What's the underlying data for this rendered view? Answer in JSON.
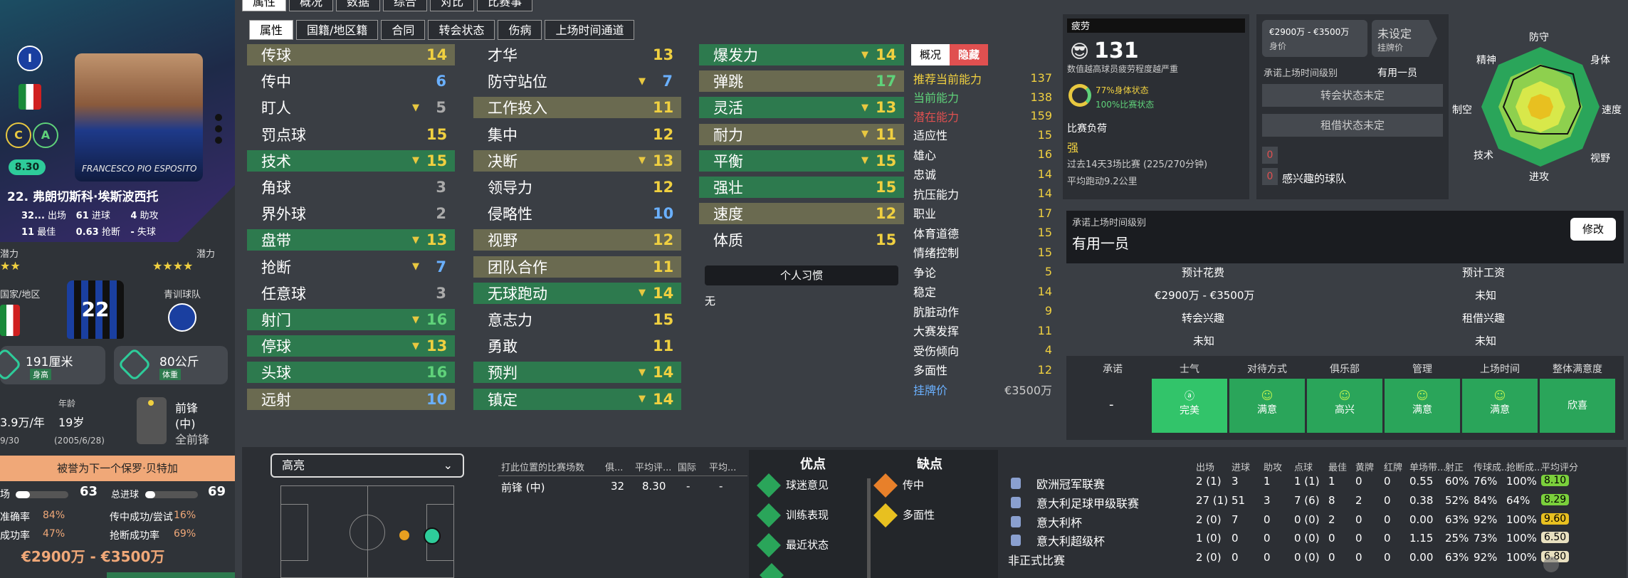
{
  "card": {
    "rating": "8.30",
    "photo_name": "FRANCESCO PIO ESPOSITO",
    "name": "22. 弗朗切斯科·埃斯波西托",
    "badge_c": "C",
    "badge_a": "A",
    "nation_short": "ITALIA",
    "stats": [
      {
        "v": "32...",
        "k": "出场"
      },
      {
        "v": "61",
        "k": "进球"
      },
      {
        "v": "4",
        "k": "助攻"
      },
      {
        "v": "11",
        "k": "最佳"
      },
      {
        "v": "0.63",
        "k": "抢断"
      },
      {
        "v": "-",
        "k": "失球"
      }
    ],
    "potential_left": "潜力",
    "potential_right": "潜力",
    "left_stars": "★★",
    "right_stars": "★★★★",
    "nation_label": "国家/地区",
    "kit_number": "22",
    "youth_label": "青训球队",
    "height": "191厘米",
    "height_sub": "身高",
    "weight": "80公斤",
    "weight_sub": "体重",
    "wage": "3.9万/年",
    "age_label": "年龄",
    "age": "19岁",
    "contract_end": "9/30",
    "dob": "(2005/6/28)",
    "pos_main": "前锋",
    "pos_sub": "(中)",
    "pos_all": "全前锋",
    "compare_banner": "被誉为下一个保罗·贝特加",
    "goals_left_label": "场",
    "goals_left": "63",
    "goals_total_label": "总进球",
    "goals_total": "69",
    "rates": [
      {
        "k": "准确率",
        "v": "84%",
        "k2": "传中成功/尝试",
        "v2": "16%"
      },
      {
        "k": "成功率",
        "v": "47%",
        "k2": "抢断成功率",
        "v2": "69%"
      }
    ],
    "value": "€2900万 - €3500万"
  },
  "tabs_top": [
    "属性",
    "概况",
    "数据",
    "综合",
    "对比",
    "比赛事"
  ],
  "tabs2": [
    "属性",
    "国籍/地区籍",
    "合同",
    "转会状态",
    "伤病",
    "上场时间通道"
  ],
  "attrs_tech": [
    {
      "n": "传球",
      "v": "14",
      "arrow": "",
      "bg": "y",
      "c": "v-y"
    },
    {
      "n": "传中",
      "v": "6",
      "arrow": "",
      "bg": "",
      "c": "v-b"
    },
    {
      "n": "盯人",
      "v": "5",
      "arrow": "▼",
      "bg": "",
      "c": "v-g"
    },
    {
      "n": "罚点球",
      "v": "15",
      "arrow": "",
      "bg": "",
      "c": "v-y"
    },
    {
      "n": "技术",
      "v": "15",
      "arrow": "▼",
      "bg": "g",
      "c": "v-y"
    },
    {
      "n": "角球",
      "v": "3",
      "arrow": "",
      "bg": "",
      "c": "v-g"
    },
    {
      "n": "界外球",
      "v": "2",
      "arrow": "",
      "bg": "",
      "c": "v-g"
    },
    {
      "n": "盘带",
      "v": "13",
      "arrow": "▼",
      "bg": "g",
      "c": "v-y"
    },
    {
      "n": "抢断",
      "v": "7",
      "arrow": "▼",
      "bg": "",
      "c": "v-b"
    },
    {
      "n": "任意球",
      "v": "3",
      "arrow": "",
      "bg": "",
      "c": "v-g"
    },
    {
      "n": "射门",
      "v": "16",
      "arrow": "▼",
      "bg": "g",
      "c": "v-gr"
    },
    {
      "n": "停球",
      "v": "13",
      "arrow": "▼",
      "bg": "g",
      "c": "v-y"
    },
    {
      "n": "头球",
      "v": "16",
      "arrow": "",
      "bg": "g",
      "c": "v-gr"
    },
    {
      "n": "远射",
      "v": "10",
      "arrow": "",
      "bg": "y",
      "c": "v-b"
    }
  ],
  "attrs_mental": [
    {
      "n": "才华",
      "v": "13",
      "arrow": "",
      "bg": "",
      "c": "v-y"
    },
    {
      "n": "防守站位",
      "v": "7",
      "arrow": "▼",
      "bg": "",
      "c": "v-b"
    },
    {
      "n": "工作投入",
      "v": "11",
      "arrow": "",
      "bg": "y",
      "c": "v-y"
    },
    {
      "n": "集中",
      "v": "12",
      "arrow": "",
      "bg": "",
      "c": "v-y"
    },
    {
      "n": "决断",
      "v": "13",
      "arrow": "▼",
      "bg": "y",
      "c": "v-y"
    },
    {
      "n": "领导力",
      "v": "12",
      "arrow": "",
      "bg": "",
      "c": "v-y"
    },
    {
      "n": "侵略性",
      "v": "10",
      "arrow": "",
      "bg": "",
      "c": "v-b"
    },
    {
      "n": "视野",
      "v": "12",
      "arrow": "",
      "bg": "y",
      "c": "v-y"
    },
    {
      "n": "团队合作",
      "v": "11",
      "arrow": "",
      "bg": "y",
      "c": "v-y"
    },
    {
      "n": "无球跑动",
      "v": "14",
      "arrow": "▼",
      "bg": "g",
      "c": "v-y"
    },
    {
      "n": "意志力",
      "v": "15",
      "arrow": "",
      "bg": "",
      "c": "v-y"
    },
    {
      "n": "勇敢",
      "v": "11",
      "arrow": "",
      "bg": "",
      "c": "v-y"
    },
    {
      "n": "预判",
      "v": "14",
      "arrow": "▼",
      "bg": "g",
      "c": "v-y"
    },
    {
      "n": "镇定",
      "v": "14",
      "arrow": "▼",
      "bg": "g",
      "c": "v-y"
    }
  ],
  "attrs_phys": [
    {
      "n": "爆发力",
      "v": "14",
      "arrow": "▼",
      "bg": "g",
      "c": "v-y"
    },
    {
      "n": "弹跳",
      "v": "17",
      "arrow": "",
      "bg": "y",
      "c": "v-gr"
    },
    {
      "n": "灵活",
      "v": "13",
      "arrow": "▼",
      "bg": "g",
      "c": "v-y"
    },
    {
      "n": "耐力",
      "v": "11",
      "arrow": "▼",
      "bg": "y",
      "c": "v-y"
    },
    {
      "n": "平衡",
      "v": "15",
      "arrow": "▼",
      "bg": "g",
      "c": "v-y"
    },
    {
      "n": "强壮",
      "v": "15",
      "arrow": "",
      "bg": "g",
      "c": "v-y"
    },
    {
      "n": "速度",
      "v": "12",
      "arrow": "",
      "bg": "y",
      "c": "v-y"
    },
    {
      "n": "体质",
      "v": "15",
      "arrow": "",
      "bg": "",
      "c": "v-y"
    }
  ],
  "traits_header": "个人习惯",
  "traits_none": "无",
  "side_tabs": [
    "概况",
    "隐藏"
  ],
  "side_ca": [
    {
      "k": "推荐当前能力",
      "v": "137",
      "kc": "#f0d040"
    },
    {
      "k": "当前能力",
      "v": "138",
      "kc": "#5fd27a"
    },
    {
      "k": "潜在能力",
      "v": "159",
      "kc": "#e05050"
    }
  ],
  "side_hidden": [
    {
      "k": "适应性",
      "v": "15"
    },
    {
      "k": "雄心",
      "v": "16"
    },
    {
      "k": "忠诚",
      "v": "14"
    },
    {
      "k": "抗压能力",
      "v": "14"
    },
    {
      "k": "职业",
      "v": "17"
    },
    {
      "k": "体育道德",
      "v": "15"
    },
    {
      "k": "情绪控制",
      "v": "15"
    },
    {
      "k": "争论",
      "v": "5"
    },
    {
      "k": "稳定",
      "v": "14"
    },
    {
      "k": "肮脏动作",
      "v": "9"
    },
    {
      "k": "大赛发挥",
      "v": "11"
    },
    {
      "k": "受伤倾向",
      "v": "4"
    },
    {
      "k": "多面性",
      "v": "12"
    }
  ],
  "side_value_label": "挂牌价",
  "side_value": "€3500万",
  "fatigue": {
    "label": "疲劳",
    "value": "131",
    "desc": "数值越高球员疲劳程度越严重",
    "phys": "77%身体状态",
    "match": "100%比赛状态",
    "load_label": "比赛负荷",
    "load_value": "强",
    "load_desc": "过去14天3场比赛 (225/270分钟)",
    "distance": "平均跑动9.2公里"
  },
  "transfer": {
    "value": "€2900万 - €3500万",
    "value_sub": "身价",
    "asking": "未设定",
    "asking_sub": "挂牌价",
    "promise_label": "承诺上场时间级别",
    "promise_value": "有用一员",
    "status1": "转会状态未定",
    "status2": "租借状态未定",
    "interest_count1": "0",
    "interest_count2": "0",
    "interest_label": "感兴趣的球队"
  },
  "radar": {
    "labels": [
      "防守",
      "身体",
      "速度",
      "视野",
      "进攻",
      "技术",
      "制空",
      "精神"
    ]
  },
  "promise_box": {
    "label": "承诺上场时间级别",
    "value": "有用一员",
    "button": "修改"
  },
  "forecast": {
    "fee_label": "预计花费",
    "fee": "€2900万 - €3500万",
    "wage_label": "预计工资",
    "wage": "未知",
    "transfer_interest_label": "转会兴趣",
    "transfer_interest": "未知",
    "loan_interest_label": "租借兴趣",
    "loan_interest": "未知"
  },
  "satisfaction": {
    "heads": [
      "承诺",
      "士气",
      "对待方式",
      "俱乐部",
      "管理",
      "上场时间",
      "整体满意度"
    ],
    "promise": "-",
    "cells": [
      "完美",
      "满意",
      "高兴",
      "满意",
      "满意",
      "欣喜"
    ]
  },
  "highlight_select": "高亮",
  "positions_table": {
    "heads": [
      "打此位置的比赛场数",
      "俱...",
      "平均评...",
      "国际",
      "平均..."
    ],
    "row": [
      "前锋 (中)",
      "32",
      "8.30",
      "-",
      "-"
    ]
  },
  "pros_label": "优点",
  "cons_label": "缺点",
  "pros": [
    "球迷意见",
    "训练表现",
    "最近状态"
  ],
  "cons": [
    "传中",
    "多面性"
  ],
  "comp_heads": [
    "出场",
    "进球",
    "助攻",
    "点球",
    "最佳",
    "黄牌",
    "红牌",
    "单场带...",
    "射正",
    "传球成...",
    "抢断成...",
    "平均评分"
  ],
  "competitions": [
    {
      "name": "欧洲冠军联赛",
      "vals": [
        "2 (1)",
        "3",
        "1",
        "1 (1)",
        "1",
        "0",
        "0",
        "0.55",
        "60%",
        "76%",
        "100%"
      ],
      "rating": "8.10"
    },
    {
      "name": "意大利足球甲级联赛",
      "vals": [
        "27 (1)",
        "51",
        "3",
        "7 (6)",
        "8",
        "2",
        "0",
        "0.38",
        "52%",
        "84%",
        "64%"
      ],
      "rating": "8.29"
    },
    {
      "name": "意大利杯",
      "vals": [
        "2 (0)",
        "7",
        "0",
        "0 (0)",
        "2",
        "0",
        "0",
        "0.00",
        "63%",
        "92%",
        "100%"
      ],
      "rating": "9.60"
    },
    {
      "name": "意大利超级杯",
      "vals": [
        "1 (0)",
        "0",
        "0",
        "0 (0)",
        "0",
        "0",
        "0",
        "1.15",
        "25%",
        "73%",
        "100%"
      ],
      "rating": "6.50"
    },
    {
      "name": "非正式比赛",
      "vals": [
        "2 (0)",
        "0",
        "0",
        "0 (0)",
        "0",
        "0",
        "0",
        "0.00",
        "63%",
        "92%",
        "100%"
      ],
      "rating": "6.80"
    }
  ],
  "colors": {
    "green": "#2d7a4e",
    "accent": "#5fd27a",
    "yellow": "#f0d040"
  }
}
